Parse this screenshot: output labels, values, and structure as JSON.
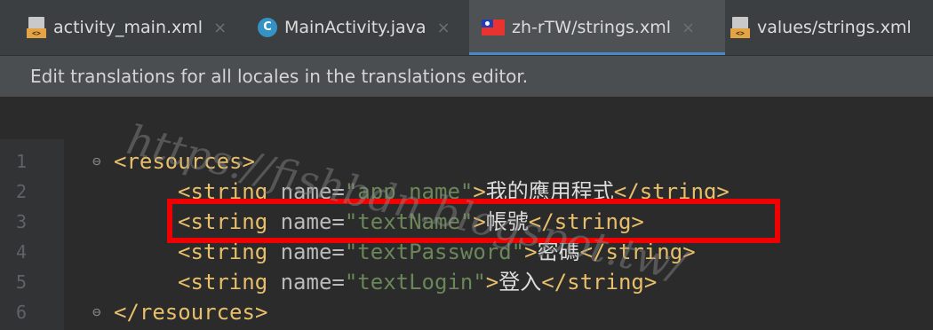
{
  "tabs": [
    {
      "label": "activity_main.xml",
      "icon": "xml-file-icon",
      "active": false
    },
    {
      "label": "MainActivity.java",
      "icon": "java-class-icon",
      "active": false
    },
    {
      "label": "zh-rTW/strings.xml",
      "icon": "taiwan-flag-icon",
      "active": true
    },
    {
      "label": "values/strings.xml",
      "icon": "xml-file-icon",
      "active": false
    }
  ],
  "xml_badge": "<>",
  "class_badge": "C",
  "close_symbol": "×",
  "info_message": "Edit translations for all locales in the translations editor.",
  "code": {
    "line_numbers": [
      "1",
      "2",
      "3",
      "4",
      "5",
      "6"
    ],
    "l1": {
      "open": "<resources>"
    },
    "l2": {
      "open": "<string ",
      "attr": "name=",
      "val": "\"app_name\"",
      "gt": ">",
      "text": "我的應用程式",
      "close": "</string>"
    },
    "l3": {
      "open": "<string ",
      "attr": "name=",
      "val": "\"textName\"",
      "gt": ">",
      "text": "帳號",
      "close": "</string>"
    },
    "l4": {
      "open": "<string ",
      "attr": "name=",
      "val": "\"textPassword\"",
      "gt": ">",
      "text": "密碼",
      "close": "</string>"
    },
    "l5": {
      "open": "<string ",
      "attr": "name=",
      "val": "\"textLogin\"",
      "gt": ">",
      "text": "登入",
      "close": "</string>"
    },
    "l6": {
      "open": "</resources>"
    }
  },
  "watermark": "https://fishbdn.blogspot.tw/",
  "colors": {
    "highlight": "#f00000",
    "tag": "#e8bf6a",
    "value": "#6a8759",
    "active_tab_underline": "#4a88c7"
  }
}
